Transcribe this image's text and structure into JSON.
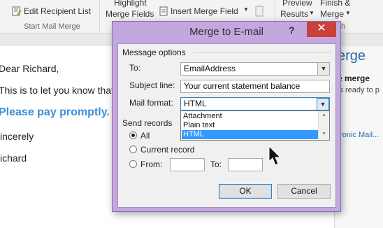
{
  "ribbon": {
    "edit_recipient_list": "Edit Recipient List",
    "highlight_merge_fields_1": "Highlight",
    "highlight_merge_fields_2": "Merge Fields",
    "insert_merge_field": "Insert Merge Field",
    "preview_results_1": "Preview",
    "preview_results_2": "Results",
    "finish_merge_1": "Finish &",
    "finish_merge_2": "Merge",
    "group_start_mail_merge": "Start Mail Merge",
    "group_finish_partial": "h"
  },
  "document": {
    "greeting": "Dear Richard,",
    "body": "This is to let you know that",
    "highlight": "Please pay promptly.",
    "closing": "incerely",
    "signature": "ichard"
  },
  "pane": {
    "title": "erge",
    "subtitle": "e merge",
    "line": "is ready to p",
    "link": "tronic Mail..."
  },
  "dialog": {
    "title": "Merge to E-mail",
    "help_label": "?",
    "close_label": "✕",
    "message_options_label": "Message options",
    "to_label": "To:",
    "to_value": "EmailAddress",
    "subject_label": "Subject line:",
    "subject_value": "Your current statement balance",
    "mail_format_label": "Mail format:",
    "mail_format_value": "HTML",
    "mail_format_options": [
      "Attachment",
      "Plain text",
      "HTML"
    ],
    "send_records_label": "Send records",
    "radio_all": "All",
    "radio_current": "Current record",
    "radio_from": "From:",
    "to_range_label": "To:",
    "from_value": "",
    "to_range_value": "",
    "ok_label": "OK",
    "cancel_label": "Cancel",
    "selected_radio": "All"
  },
  "colors": {
    "dialog_frame": "#c3a7df",
    "close_button": "#c9413a",
    "selection": "#3399ff",
    "highlight_text": "#3d8fd6"
  }
}
